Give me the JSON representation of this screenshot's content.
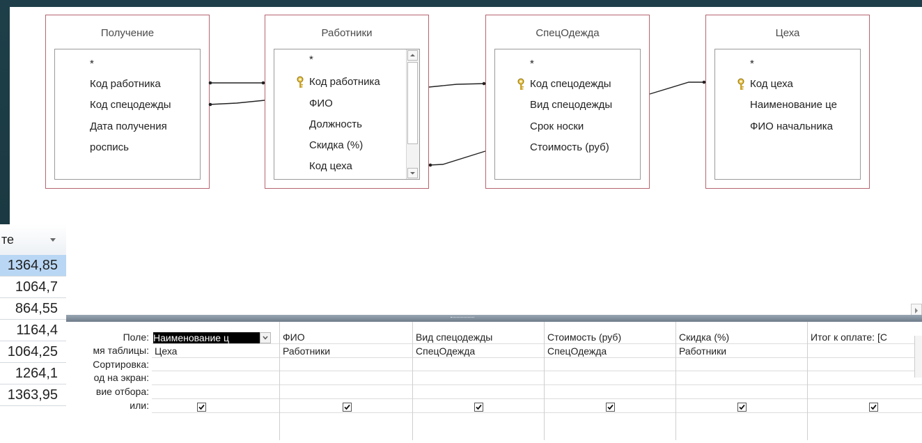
{
  "tables": [
    {
      "title": "Получение",
      "fields": [
        "*",
        "Код работника",
        "Код спецодежды",
        "Дата получения",
        "роспись"
      ],
      "key_index": -1,
      "scrollbar": false
    },
    {
      "title": "Работники",
      "fields": [
        "*",
        "Код работника",
        "ФИО",
        "Должность",
        "Скидка (%)",
        "Код цеха"
      ],
      "key_index": 1,
      "scrollbar": true
    },
    {
      "title": "СпецОдежда",
      "fields": [
        "*",
        "Код спецодежды",
        "Вид спецодежды",
        "Срок носки",
        "Стоимость (руб)"
      ],
      "key_index": 1,
      "scrollbar": false
    },
    {
      "title": "Цеха",
      "fields": [
        "*",
        "Код цеха",
        "Наименование це",
        "ФИО начальника"
      ],
      "key_index": 1,
      "scrollbar": false
    }
  ],
  "qbe": {
    "row_labels": [
      "Поле:",
      "мя таблицы:",
      "Сортировка:",
      "од на экран:",
      "вие отбора:",
      "или:"
    ],
    "columns": [
      {
        "field": "Наименование ц",
        "table": "Цеха",
        "show": true
      },
      {
        "field": "ФИО",
        "table": "Работники",
        "show": true
      },
      {
        "field": "Вид спецодежды",
        "table": "СпецОдежда",
        "show": true
      },
      {
        "field": "Стоимость (руб)",
        "table": "СпецОдежда",
        "show": true
      },
      {
        "field": "Скидка (%)",
        "table": "Работники",
        "show": true
      },
      {
        "field": "Итог к оплате: [С",
        "table": "",
        "show": true
      }
    ]
  },
  "datasheet": {
    "header": "те",
    "values": [
      "1364,85",
      "1064,7",
      "864,55",
      "1164,4",
      "1064,25",
      "1264,1",
      "1363,95"
    ]
  },
  "colors": {
    "accent_border": "#b5646f",
    "selection": "#b9d7f4",
    "background": "#1e3f49"
  }
}
